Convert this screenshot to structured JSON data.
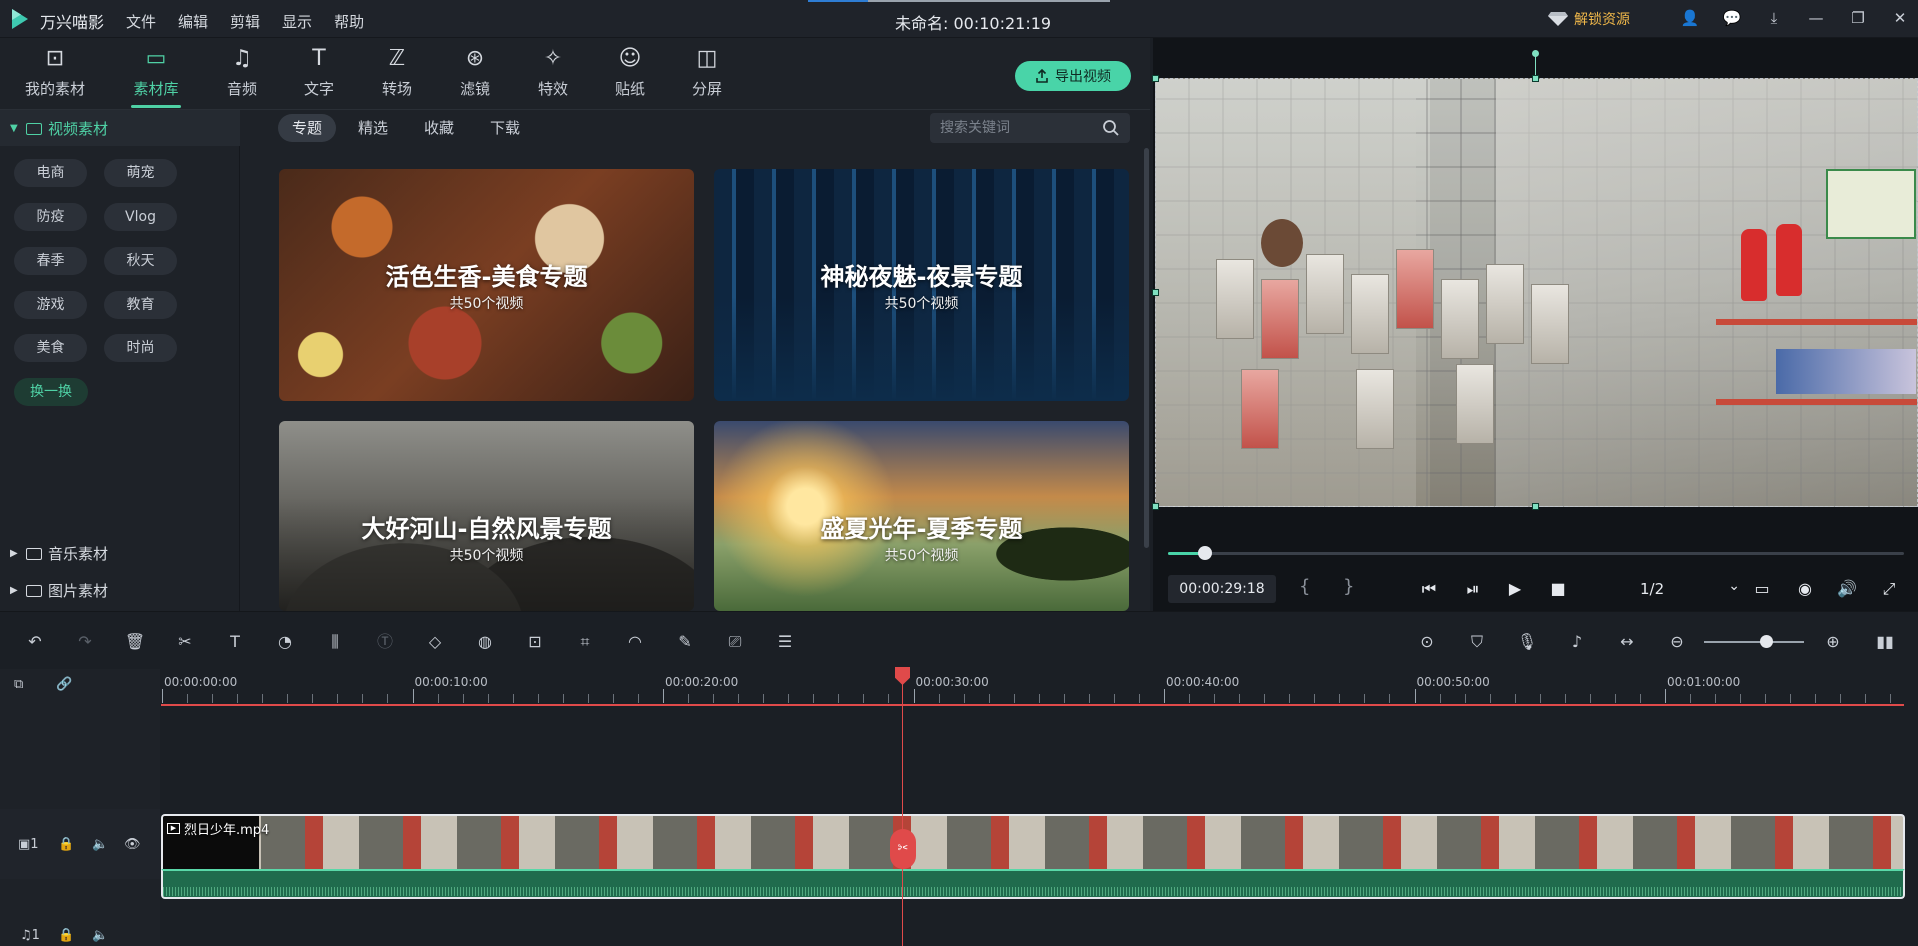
{
  "titlebar": {
    "app_name": "万兴喵影",
    "menu": [
      "文件",
      "编辑",
      "剪辑",
      "显示",
      "帮助"
    ],
    "doc_title": "未命名: 00:10:21:19",
    "unlock_label": "解锁资源",
    "icons": [
      "account-icon",
      "feedback-icon",
      "download-icon",
      "minimize-icon",
      "restore-icon",
      "close-icon"
    ]
  },
  "categories": [
    {
      "label": "我的素材",
      "icon": "media-icon"
    },
    {
      "label": "素材库",
      "icon": "library-icon",
      "active": true
    },
    {
      "label": "音频",
      "icon": "music-icon"
    },
    {
      "label": "文字",
      "icon": "text-icon"
    },
    {
      "label": "转场",
      "icon": "transition-icon"
    },
    {
      "label": "滤镜",
      "icon": "filter-icon"
    },
    {
      "label": "特效",
      "icon": "effects-icon"
    },
    {
      "label": "贴纸",
      "icon": "sticker-icon"
    },
    {
      "label": "分屏",
      "icon": "splitscreen-icon"
    }
  ],
  "export_label": "导出视频",
  "tree": {
    "video": "视频素材",
    "music": "音乐素材",
    "image": "图片素材"
  },
  "tags": [
    "电商",
    "萌宠",
    "防疫",
    "Vlog",
    "春季",
    "秋天",
    "游戏",
    "教育",
    "美食",
    "时尚",
    "换一换"
  ],
  "subtabs": [
    "专题",
    "精选",
    "收藏",
    "下载"
  ],
  "search_placeholder": "搜索关键词",
  "cards": [
    {
      "title": "活色生香-美食专题",
      "sub": "共50个视频"
    },
    {
      "title": "神秘夜魅-夜景专题",
      "sub": "共50个视频"
    },
    {
      "title": "大好河山-自然风景专题",
      "sub": "共50个视频"
    },
    {
      "title": "盛夏光年-夏季专题",
      "sub": "共50个视频"
    }
  ],
  "player": {
    "timecode": "00:00:29:18",
    "ratio": "1/2",
    "progress": 0.05
  },
  "ruler_labels": [
    "00:00:00:00",
    "00:00:10:00",
    "00:00:20:00",
    "00:00:30:00",
    "00:00:40:00",
    "00:00:50:00",
    "00:01:00:00"
  ],
  "clip": {
    "name": "烈日少年.mp4"
  },
  "tracks": {
    "video_label": "1",
    "audio_label": "1"
  }
}
